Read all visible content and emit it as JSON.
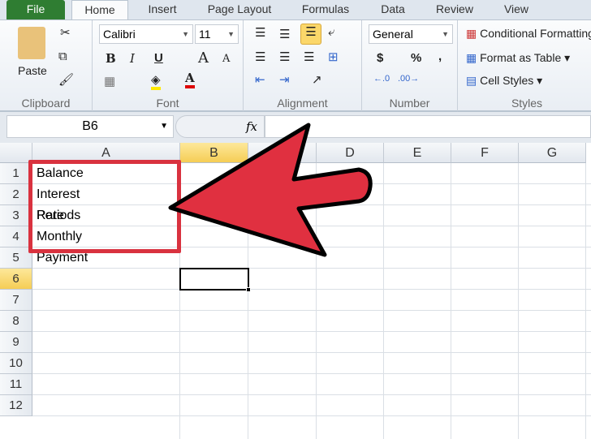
{
  "ribbon_tabs": [
    "File",
    "Home",
    "Insert",
    "Page Layout",
    "Formulas",
    "Data",
    "Review",
    "View"
  ],
  "clipboard": {
    "paste": "Paste",
    "label": "Clipboard"
  },
  "font": {
    "name": "Calibri",
    "size": "11",
    "label": "Font"
  },
  "alignment": {
    "label": "Alignment"
  },
  "number": {
    "format": "General",
    "label": "Number",
    "currency": "$",
    "percent": "%",
    "comma": ","
  },
  "styles": {
    "conditional": "Conditional Formatting",
    "format_table": "Format as Table",
    "cell_styles": "Cell Styles",
    "label": "Styles"
  },
  "formula_bar": {
    "name_box": "B6",
    "fx": "fx",
    "value": ""
  },
  "columns": [
    "A",
    "B",
    "C",
    "D",
    "E",
    "F",
    "G"
  ],
  "rows": [
    "1",
    "2",
    "3",
    "4",
    "5",
    "6",
    "7",
    "8",
    "9",
    "10",
    "11",
    "12"
  ],
  "cells": {
    "A1": "Balance",
    "A2": "Interest Rate",
    "A3": "Periods",
    "A4": "Monthly Payment"
  },
  "selected_cell": "B6",
  "annotation_color": "#e03040"
}
